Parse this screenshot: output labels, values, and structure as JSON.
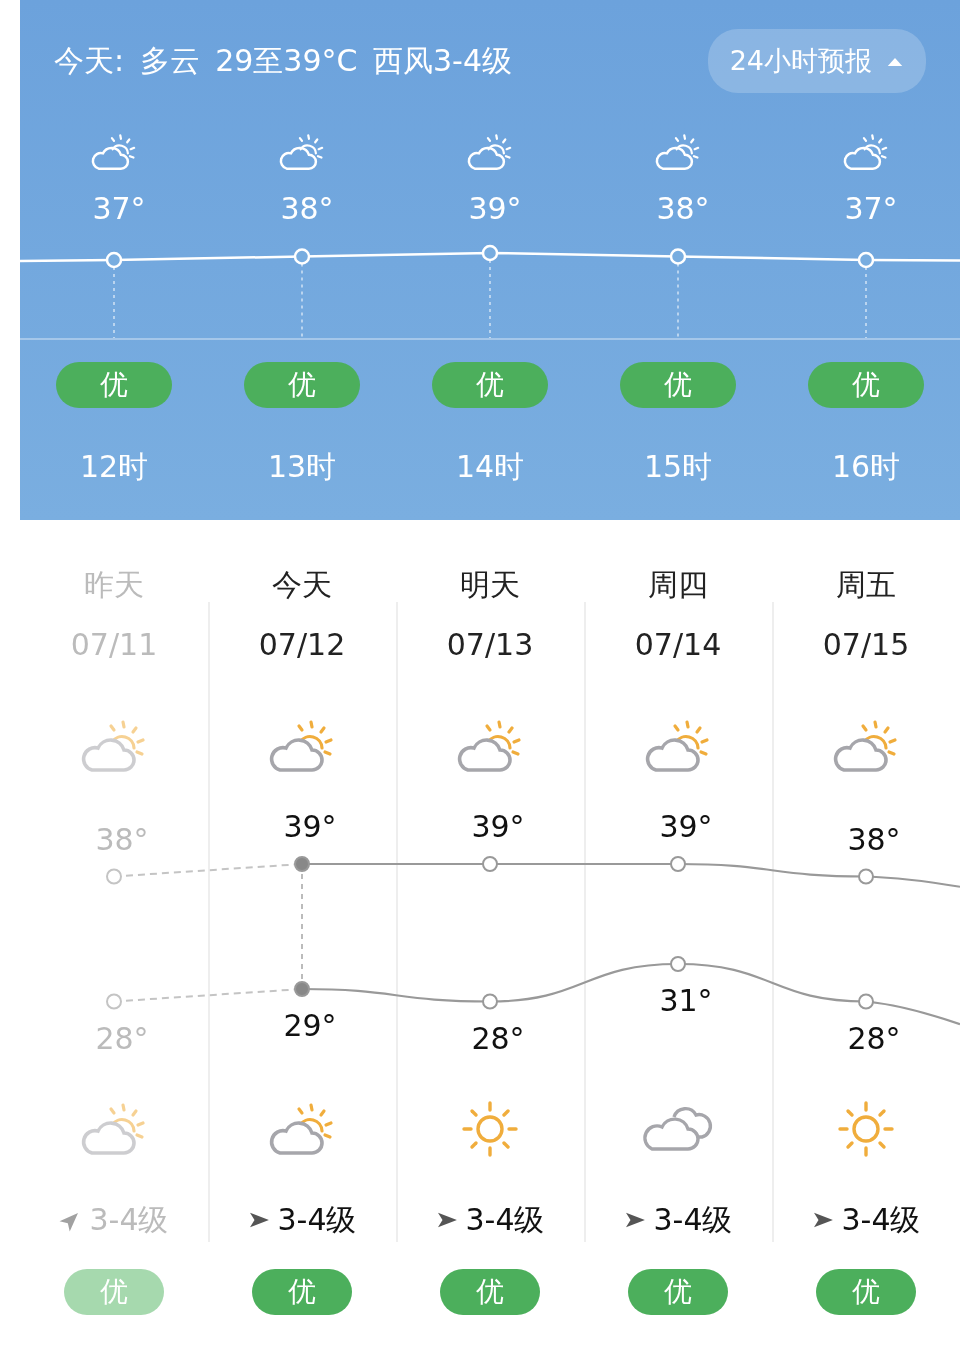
{
  "header": {
    "summary": "今天: 多云 29至39°C 西风3-4级",
    "forecast_button": {
      "label": "24小时预报",
      "expanded": true
    }
  },
  "hourly": [
    {
      "icon": {
        "kind": "partly_cloudy"
      },
      "temp": "37°",
      "aqi": "优",
      "time": "12时"
    },
    {
      "icon": {
        "kind": "partly_cloudy"
      },
      "temp": "38°",
      "aqi": "优",
      "time": "13时"
    },
    {
      "icon": {
        "kind": "partly_cloudy"
      },
      "temp": "39°",
      "aqi": "优",
      "time": "14时"
    },
    {
      "icon": {
        "kind": "partly_cloudy"
      },
      "temp": "38°",
      "aqi": "优",
      "time": "15时"
    },
    {
      "icon": {
        "kind": "partly_cloudy"
      },
      "temp": "37°",
      "aqi": "优",
      "time": "16时"
    }
  ],
  "daily": [
    {
      "day": "昨天",
      "date": "07/11",
      "past": true,
      "selected": false,
      "day_icon": {
        "kind": "partly_cloudy"
      },
      "high": "38°",
      "low": "28°",
      "night_icon": {
        "kind": "partly_cloudy"
      },
      "wind_arrow": {
        "kind": "northeast"
      },
      "wind": "3-4级",
      "aqi": "优"
    },
    {
      "day": "今天",
      "date": "07/12",
      "past": false,
      "selected": true,
      "day_icon": {
        "kind": "partly_cloudy"
      },
      "high": "39°",
      "low": "29°",
      "night_icon": {
        "kind": "partly_cloudy"
      },
      "wind_arrow": {
        "kind": "east"
      },
      "wind": "3-4级",
      "aqi": "优"
    },
    {
      "day": "明天",
      "date": "07/13",
      "past": false,
      "selected": false,
      "day_icon": {
        "kind": "partly_cloudy"
      },
      "high": "39°",
      "low": "28°",
      "night_icon": {
        "kind": "sunny"
      },
      "wind_arrow": {
        "kind": "east"
      },
      "wind": "3-4级",
      "aqi": "优"
    },
    {
      "day": "周四",
      "date": "07/14",
      "past": false,
      "selected": false,
      "day_icon": {
        "kind": "partly_cloudy"
      },
      "high": "39°",
      "low": "31°",
      "night_icon": {
        "kind": "cloudy"
      },
      "wind_arrow": {
        "kind": "east"
      },
      "wind": "3-4级",
      "aqi": "优"
    },
    {
      "day": "周五",
      "date": "07/15",
      "past": false,
      "selected": false,
      "day_icon": {
        "kind": "partly_cloudy"
      },
      "high": "38°",
      "low": "28°",
      "night_icon": {
        "kind": "sunny"
      },
      "wind_arrow": {
        "kind": "east"
      },
      "wind": "3-4级",
      "aqi": "优"
    }
  ]
}
